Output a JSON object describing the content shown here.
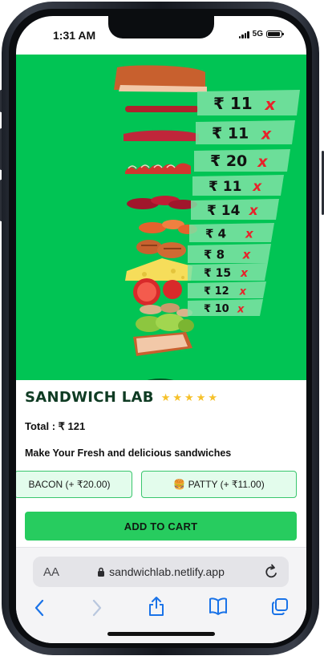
{
  "status_bar": {
    "time": "1:31 AM",
    "network": "5G"
  },
  "hero": {
    "prices": [
      {
        "amount": "₹ 11",
        "remove": "x"
      },
      {
        "amount": "₹ 11",
        "remove": "x"
      },
      {
        "amount": "₹ 20",
        "remove": "x"
      },
      {
        "amount": "₹ 11",
        "remove": "x"
      },
      {
        "amount": "₹ 14",
        "remove": "x"
      },
      {
        "amount": "₹ 4",
        "remove": "x"
      },
      {
        "amount": "₹ 8",
        "remove": "x"
      },
      {
        "amount": "₹ 15",
        "remove": "x"
      },
      {
        "amount": "₹ 12",
        "remove": "x"
      },
      {
        "amount": "₹ 10",
        "remove": "x"
      }
    ],
    "background_color": "#01c454"
  },
  "app": {
    "title": "SANDWICH LAB",
    "rating_stars": 5,
    "total": "Total : ₹ 121",
    "tagline": "Make Your Fresh and delicious sandwiches",
    "ingredient_buttons": [
      {
        "icon": "bacon",
        "label": "BACON (+ ₹20.00)"
      },
      {
        "icon": "burger-emoji",
        "label": "🍔 PATTY (+ ₹11.00)"
      }
    ],
    "add_to_cart": "ADD TO CART"
  },
  "browser": {
    "text_size_label": "AA",
    "url": "sandwichlab.netlify.app"
  },
  "colors": {
    "accent_green": "#27cc5f",
    "title_green": "#0f3b23",
    "remove_red": "#e8222a",
    "star_yellow": "#f6c12a"
  }
}
